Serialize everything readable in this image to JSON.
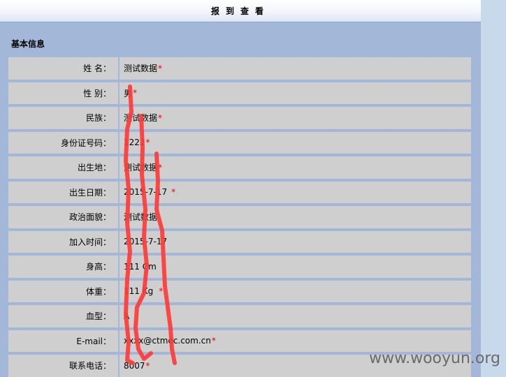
{
  "header": {
    "title": "报到查看"
  },
  "section": {
    "title": "基本信息"
  },
  "fields": [
    {
      "label": "姓 名：",
      "value": "测试数据",
      "required": "*"
    },
    {
      "label": "性 别：",
      "value": "男",
      "required": "*"
    },
    {
      "label": "民族：",
      "value": "测试数据",
      "required": "*"
    },
    {
      "label": "身份证号码：",
      "value": "1222",
      "required": "*"
    },
    {
      "label": "出生地：",
      "value": "测试数据",
      "required": "*"
    },
    {
      "label": "出生日期：",
      "value": "2015-7-17",
      "required": "*"
    },
    {
      "label": "政治面貌：",
      "value": "测试数据",
      "required": ""
    },
    {
      "label": "加入时间：",
      "value": "2015-7-17",
      "required": ""
    },
    {
      "label": "身高：",
      "value": "111 Cm",
      "required": ""
    },
    {
      "label": "体重：",
      "value": "111 Kg",
      "required": "*"
    },
    {
      "label": "血型：",
      "value": "A",
      "required": ""
    },
    {
      "label": "E-mail：",
      "value": "xxxx@ctmec.com.cn",
      "required": "*"
    },
    {
      "label": "联系电话：",
      "value": "8007",
      "required": "*"
    }
  ],
  "watermark": "www.wooyun.org",
  "colors": {
    "panel": "#a3b8d9",
    "cell": "#cfcfcf",
    "required": "#e00000",
    "scribble": "#ff3b3b"
  }
}
